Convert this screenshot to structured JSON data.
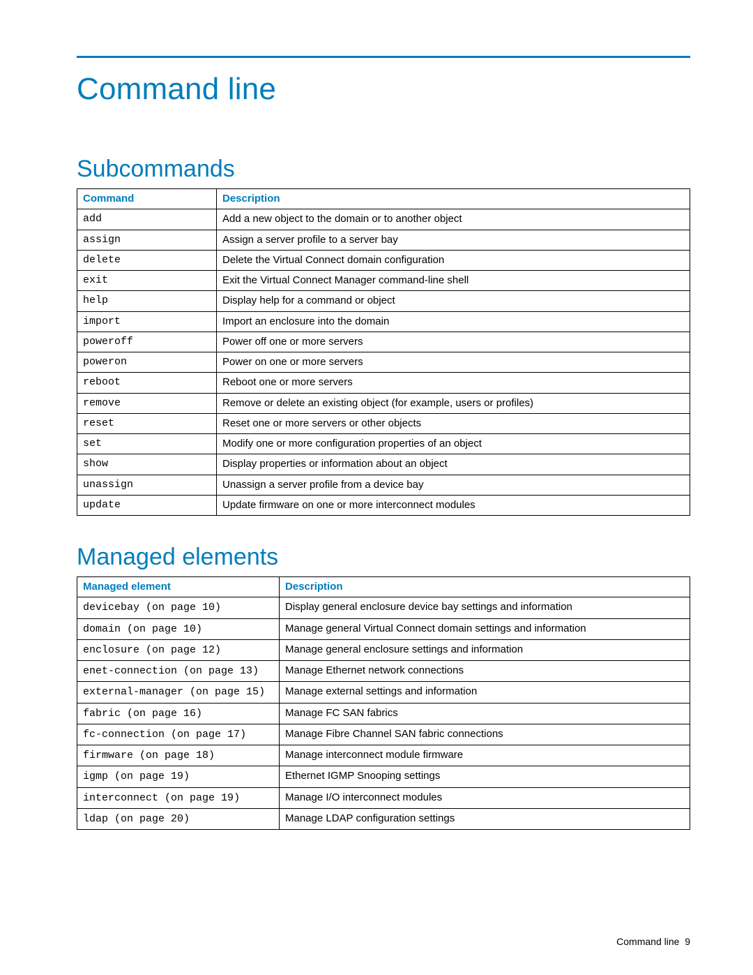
{
  "title": "Command line",
  "sections": {
    "subcommands": {
      "heading": "Subcommands",
      "headers": {
        "c1": "Command",
        "c2": "Description"
      },
      "rows": [
        {
          "cmd": "add",
          "desc": "Add a new object to the domain or to another object"
        },
        {
          "cmd": "assign",
          "desc": "Assign a server profile to a server bay"
        },
        {
          "cmd": "delete",
          "desc": "Delete the Virtual Connect domain configuration"
        },
        {
          "cmd": "exit",
          "desc": "Exit the Virtual Connect Manager command-line shell"
        },
        {
          "cmd": "help",
          "desc": "Display help for a command or object"
        },
        {
          "cmd": "import",
          "desc": "Import an enclosure into the domain"
        },
        {
          "cmd": "poweroff",
          "desc": "Power off one or more servers"
        },
        {
          "cmd": "poweron",
          "desc": "Power on one or more servers"
        },
        {
          "cmd": "reboot",
          "desc": "Reboot one or more servers"
        },
        {
          "cmd": "remove",
          "desc": "Remove or delete an existing object (for example, users or profiles)"
        },
        {
          "cmd": "reset",
          "desc": "Reset one or more servers or other objects"
        },
        {
          "cmd": "set",
          "desc": "Modify one or more configuration properties of an object"
        },
        {
          "cmd": "show",
          "desc": "Display properties or information about an object"
        },
        {
          "cmd": "unassign",
          "desc": "Unassign a server profile from a device bay"
        },
        {
          "cmd": "update",
          "desc": "Update firmware on one or more interconnect modules"
        }
      ]
    },
    "elements": {
      "heading": "Managed elements",
      "headers": {
        "c1": "Managed element",
        "c2": "Description"
      },
      "rows": [
        {
          "cmd": "devicebay",
          "pg_prefix": " (on page ",
          "pg": "10",
          "pg_suffix": ")",
          "desc": "Display general enclosure device bay settings and information"
        },
        {
          "cmd": "domain",
          "pg_prefix": " (on page ",
          "pg": "10",
          "pg_suffix": ")",
          "desc": "Manage general Virtual Connect domain settings and information"
        },
        {
          "cmd": "enclosure",
          "pg_prefix": " (on page ",
          "pg": "12",
          "pg_suffix": ")",
          "desc": "Manage general enclosure settings and information"
        },
        {
          "cmd": "enet-connection",
          "pg_prefix": " (on page ",
          "pg": "13",
          "pg_suffix": ")",
          "desc": "Manage Ethernet network connections"
        },
        {
          "cmd": "external-manager",
          "pg_prefix": " (on page ",
          "pg": "15",
          "pg_suffix": ")",
          "desc": "Manage external settings and information"
        },
        {
          "cmd": "fabric",
          "pg_prefix": " (on page ",
          "pg": "16",
          "pg_suffix": ")",
          "desc": "Manage FC SAN fabrics"
        },
        {
          "cmd": "fc-connection",
          "pg_prefix": " (on page ",
          "pg": "17",
          "pg_suffix": ")",
          "desc": "Manage Fibre Channel SAN fabric connections"
        },
        {
          "cmd": "firmware",
          "pg_prefix": " (on page ",
          "pg": "18",
          "pg_suffix": ")",
          "desc": "Manage interconnect module firmware"
        },
        {
          "cmd": "igmp",
          "pg_prefix": " (on page ",
          "pg": "19",
          "pg_suffix": ")",
          "desc": "Ethernet IGMP Snooping settings"
        },
        {
          "cmd": "interconnect",
          "pg_prefix": " (on page ",
          "pg": "19",
          "pg_suffix": ")",
          "desc": "Manage I/O interconnect modules"
        },
        {
          "cmd": "ldap",
          "pg_prefix": " (on page ",
          "pg": "20",
          "pg_suffix": ")",
          "desc": "Manage LDAP configuration settings"
        }
      ]
    }
  },
  "footer": {
    "label": "Command line",
    "page_no": "9"
  }
}
